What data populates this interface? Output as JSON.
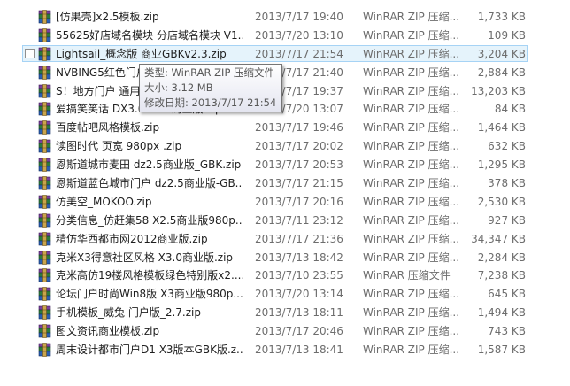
{
  "files": [
    {
      "name": "[仿果壳]x2.5模板.zip",
      "date": "2013/7/17 19:40",
      "type": "WinRAR ZIP 压缩...",
      "size": "1,733 KB"
    },
    {
      "name": "55625好店域名模块 分店域名模块 V1...",
      "date": "2013/7/20 13:10",
      "type": "WinRAR ZIP 压缩...",
      "size": "109 KB"
    },
    {
      "name": "Lightsail_概念版 商业GBKv2.3.zip",
      "date": "2013/7/17 21:54",
      "type": "WinRAR ZIP 压缩...",
      "size": "3,204 KB"
    },
    {
      "name": "NVBING5红色门户 商业版.zip",
      "date": "2013/7/17 21:40",
      "type": "WinRAR ZIP 压缩...",
      "size": "2,884 KB"
    },
    {
      "name": "S！地方门户 通用版.zip",
      "date": "2013/7/17 19:37",
      "type": "WinRAR ZIP 压缩...",
      "size": "13,203 KB"
    },
    {
      "name": "爱搞笑笑话 DX3.0-GBK商业版.zip",
      "date": "2013/7/20 13:07",
      "type": "WinRAR ZIP 压缩...",
      "size": "84 KB"
    },
    {
      "name": "百度帖吧风格模板.zip",
      "date": "2013/7/17 19:46",
      "type": "WinRAR ZIP 压缩...",
      "size": "1,464 KB"
    },
    {
      "name": "读图时代 页宽 980px .zip",
      "date": "2013/7/17 20:02",
      "type": "WinRAR ZIP 压缩...",
      "size": "632 KB"
    },
    {
      "name": "恩斯道城市麦田 dz2.5商业版_GBK.zip",
      "date": "2013/7/17 20:53",
      "type": "WinRAR ZIP 压缩...",
      "size": "1,295 KB"
    },
    {
      "name": "恩斯道蓝色城市门户 dz2.5商业版-GB...",
      "date": "2013/7/17 21:15",
      "type": "WinRAR ZIP 压缩...",
      "size": "378 KB"
    },
    {
      "name": "仿美空_MOKOO.zip",
      "date": "2013/7/17 20:16",
      "type": "WinRAR ZIP 压缩...",
      "size": "2,530 KB"
    },
    {
      "name": "分类信息_仿赶集58 X2.5商业版980p...",
      "date": "2013/7/11 23:12",
      "type": "WinRAR ZIP 压缩...",
      "size": "927 KB"
    },
    {
      "name": "精仿华西都市网2012商业版.zip",
      "date": "2013/7/17 21:36",
      "type": "WinRAR ZIP 压缩...",
      "size": "34,347 KB"
    },
    {
      "name": "克米X3得意社区风格 X3.0商业版.zip",
      "date": "2013/7/13 18:42",
      "type": "WinRAR ZIP 压缩...",
      "size": "2,284 KB"
    },
    {
      "name": "克米高仿19楼风格模板绿色特别版x2....",
      "date": "2013/7/10 23:55",
      "type": "WinRAR 压缩文件",
      "size": "7,238 KB"
    },
    {
      "name": "论坛门户时尚Win8版 X3商业版980p...",
      "date": "2013/7/20 13:14",
      "type": "WinRAR ZIP 压缩...",
      "size": "645 KB"
    },
    {
      "name": "手机模板_威兔 门户版_2.7.zip",
      "date": "2013/7/13 18:11",
      "type": "WinRAR ZIP 压缩...",
      "size": "1,494 KB"
    },
    {
      "name": "图文资讯商业模板.zip",
      "date": "2013/7/17 20:46",
      "type": "WinRAR ZIP 压缩...",
      "size": "743 KB"
    },
    {
      "name": "周末设计都市门户D1 X3版本GBK版.z...",
      "date": "2013/7/13 18:41",
      "type": "WinRAR ZIP 压缩...",
      "size": "1,587 KB"
    }
  ],
  "tooltip": {
    "type_line": "类型: WinRAR ZIP 压缩文件",
    "size_line": "大小: 3.12 MB",
    "modified_line": "修改日期: 2013/7/17 21:54"
  },
  "icon_name": "winrar-archive-icon"
}
